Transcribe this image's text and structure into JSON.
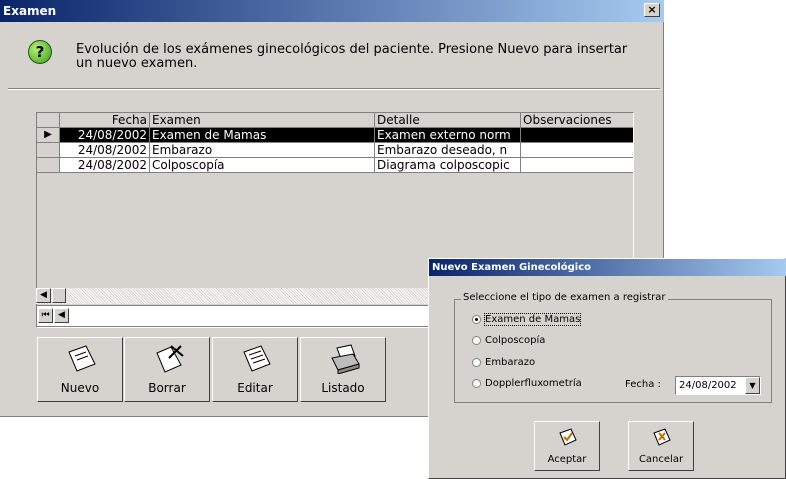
{
  "window": {
    "title": "Examen",
    "close_label": "×"
  },
  "header": {
    "description": "Evolución de los exámenes ginecológicos del paciente. Presione Nuevo para insertar un nuevo examen.",
    "icon": "help-icon"
  },
  "grid": {
    "columns": [
      "Fecha",
      "Examen",
      "Detalle",
      "Observaciones"
    ],
    "rows": [
      {
        "fecha": "24/08/2002",
        "examen": "Examen de Mamas",
        "detalle": "Examen externo norm",
        "observaciones": ""
      },
      {
        "fecha": "24/08/2002",
        "examen": "Embarazo",
        "detalle": "Embarazo deseado, n",
        "observaciones": ""
      },
      {
        "fecha": "24/08/2002",
        "examen": "Colposcopía",
        "detalle": "Diagrama colposcopic",
        "observaciones": ""
      }
    ]
  },
  "toolbar": {
    "nuevo": "Nuevo",
    "borrar": "Borrar",
    "editar": "Editar",
    "listado": "Listado"
  },
  "dialog": {
    "title": "Nuevo Examen Ginecológico",
    "group_label": "Seleccione el tipo de examen a registrar",
    "options": [
      "Examen de Mamas",
      "Colposcopía",
      "Embarazo",
      "Dopplerfluxometría"
    ],
    "selected": "Examen de Mamas",
    "fecha_label": "Fecha :",
    "fecha_value": "24/08/2002",
    "aceptar": "Aceptar",
    "cancelar": "Cancelar"
  },
  "colors": {
    "titlebar_start": "#0a246a",
    "titlebar_end": "#a6caf0",
    "face": "#d6d3ce",
    "selected_row": "#000000"
  }
}
